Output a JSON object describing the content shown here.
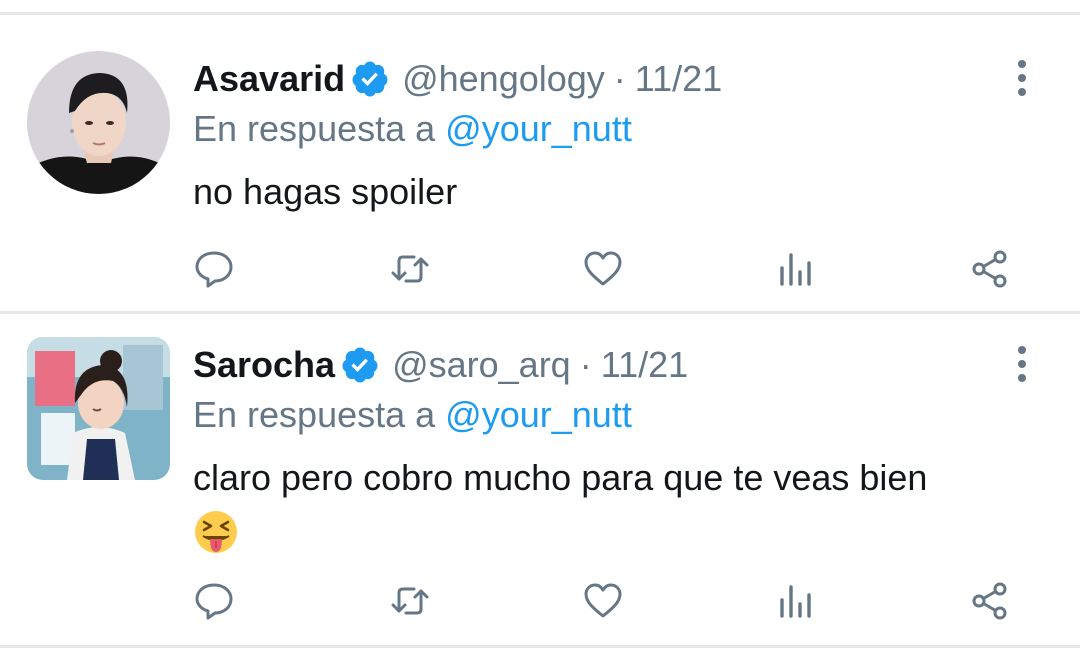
{
  "tweets": [
    {
      "name": "Asavarid",
      "handle": "@hengology",
      "separator": "·",
      "date": "11/21",
      "reply_prefix": "En respuesta a",
      "reply_to": "@your_nutt",
      "text": "no hagas spoiler",
      "verified": true,
      "avatar_shape": "circle"
    },
    {
      "name": "Sarocha",
      "handle": "@saro_arq",
      "separator": "·",
      "date": "11/21",
      "reply_prefix": "En respuesta a",
      "reply_to": "@your_nutt",
      "text": "claro pero cobro mucho para que te veas bien",
      "emoji": "squinting-face-with-tongue",
      "verified": true,
      "avatar_shape": "rounded-square"
    }
  ],
  "actions": [
    "reply-icon",
    "retweet-icon",
    "like-icon",
    "analytics-icon",
    "share-icon"
  ],
  "colors": {
    "text": "#14171a",
    "secondary": "#657786",
    "mention": "#1d9bf0",
    "verified": "#1d9bf0",
    "icon": "#657786",
    "separator": "#e7e7ea"
  }
}
